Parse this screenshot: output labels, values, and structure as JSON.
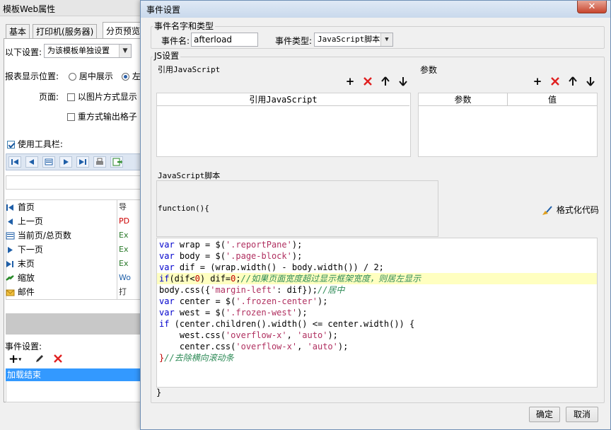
{
  "background_window": {
    "title": "模板Web属性",
    "tabs": [
      "基本",
      "打印机(服务器)",
      "分页预览"
    ],
    "settings_label": "以下设置:",
    "settings_value": "为该模板单独设置",
    "report_position_label": "报表显示位置:",
    "position_center": "居中展示",
    "position_left": "左",
    "page_label": "页面:",
    "as_image": "以图片方式显示",
    "output_grid": "重方式输出格子",
    "use_toolbar": "使用工具栏:",
    "list_items": [
      "首页",
      "上一页",
      "当前页/总页数",
      "下一页",
      "末页",
      "缩放",
      "邮件"
    ],
    "list_items_right": [
      "导",
      "PD",
      "Ex",
      "Ex",
      "Ex",
      "Wo",
      "打"
    ],
    "event_settings_label": "事件设置:",
    "selected_event": "加载结束"
  },
  "dialog": {
    "title": "事件设置",
    "close_label": "✕",
    "name_type_group": "事件名字和类型",
    "event_name_label": "事件名:",
    "event_name_value": "afterload",
    "event_type_label": "事件类型:",
    "event_type_value": "JavaScript脚本",
    "js_group": "JS设置",
    "ref_js_label": "引用JavaScript",
    "ref_js_column": "引用JavaScript",
    "params_label": "参数",
    "params_col1": "参数",
    "params_col2": "值",
    "script_label": "JavaScript脚本",
    "function_header": "function(){",
    "format_code": "格式化代码",
    "closing_brace": "}",
    "ok": "确定",
    "cancel": "取消"
  },
  "code_lines": [
    "var wrap = $('.reportPane');",
    "var body = $('.page-block');",
    "var dif = (wrap.width() - body.width()) / 2;",
    "if(dif<0) dif=0;//如果页面宽度超过显示框架宽度，则居左显示",
    "body.css({'margin-left': dif});//居中",
    "var center = $('.frozen-center');",
    "var west = $('.frozen-west');",
    "if (center.children().width() <= center.width()) {",
    "    west.css('overflow-x', 'auto');",
    "    center.css('overflow-x', 'auto');",
    "}//去除横向滚动条"
  ],
  "colors": {
    "keyword": "#0000cc",
    "string": "#b03060",
    "number": "#c00000",
    "comment": "#2e8b57",
    "highlight_line": "#ffffc0",
    "selection": "#3399ff",
    "delete_red": "#e02020"
  }
}
